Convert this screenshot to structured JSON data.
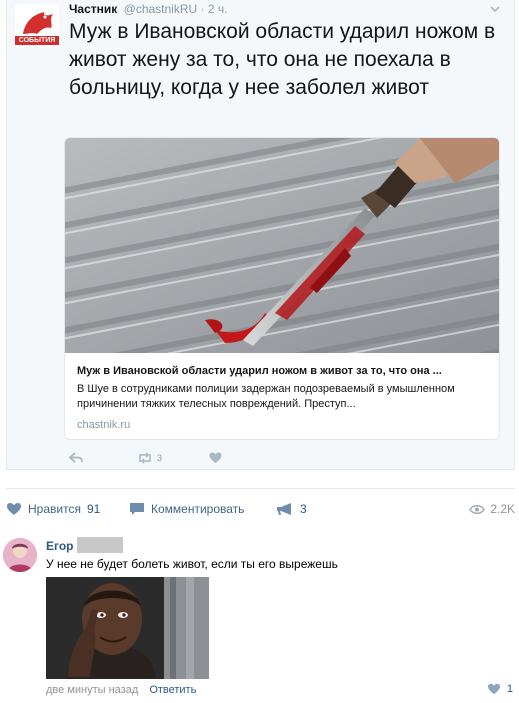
{
  "tweet": {
    "author_name": "Частник",
    "handle": "@chastnikRU",
    "time": "· 2 ч.",
    "avatar_badge": "СОБЫТИЯ",
    "text": "Муж в Ивановской области ударил ножом в живот жену за то, что она не поехала в больницу, когда у нее заболел живот",
    "link_card": {
      "title": "Муж в Ивановской области ударил ножом в живот за то, что она ...",
      "description": "В Шуе в сотрудниками полиции задержан подозреваемый в умышленном причинении  тяжких телесных повреждений. Преступ...",
      "domain": "chastnik.ru"
    },
    "actions": {
      "retweet_count": "3"
    }
  },
  "post_footer": {
    "like_label": "Нравится",
    "like_count": "91",
    "comment_label": "Комментировать",
    "share_count": "3",
    "views": "2.2K"
  },
  "comment": {
    "author": "Егор",
    "text": "У нее не будет болеть живот, если ты его вырежешь",
    "time": "две минуты назад",
    "reply_label": "Ответить",
    "like_count": "1"
  },
  "colors": {
    "vk_link": "#2a5885",
    "vk_icon": "#42648b",
    "tweet_bg": "#f5f8fa",
    "muted": "#939393"
  }
}
